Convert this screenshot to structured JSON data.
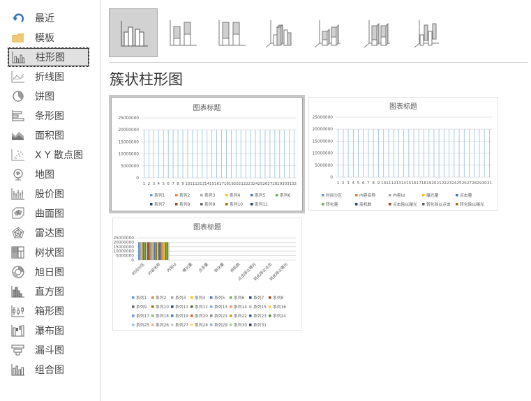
{
  "sidebar": {
    "items": [
      {
        "label": "最近",
        "icon": "recent-icon"
      },
      {
        "label": "模板",
        "icon": "folder-icon"
      },
      {
        "label": "柱形图",
        "icon": "column-chart-icon",
        "selected": true
      },
      {
        "label": "折线图",
        "icon": "line-chart-icon"
      },
      {
        "label": "饼图",
        "icon": "pie-chart-icon"
      },
      {
        "label": "条形图",
        "icon": "bar-chart-icon"
      },
      {
        "label": "面积图",
        "icon": "area-chart-icon"
      },
      {
        "label": "X Y 散点图",
        "icon": "scatter-chart-icon"
      },
      {
        "label": "地图",
        "icon": "map-chart-icon"
      },
      {
        "label": "股价图",
        "icon": "stock-chart-icon"
      },
      {
        "label": "曲面图",
        "icon": "surface-chart-icon"
      },
      {
        "label": "雷达图",
        "icon": "radar-chart-icon"
      },
      {
        "label": "树状图",
        "icon": "treemap-chart-icon"
      },
      {
        "label": "旭日图",
        "icon": "sunburst-chart-icon"
      },
      {
        "label": "直方图",
        "icon": "histogram-chart-icon"
      },
      {
        "label": "箱形图",
        "icon": "box-whisker-chart-icon"
      },
      {
        "label": "瀑布图",
        "icon": "waterfall-chart-icon"
      },
      {
        "label": "漏斗图",
        "icon": "funnel-chart-icon"
      },
      {
        "label": "组合图",
        "icon": "combo-chart-icon"
      }
    ]
  },
  "subtypes": [
    {
      "name": "clustered-column",
      "selected": true
    },
    {
      "name": "stacked-column"
    },
    {
      "name": "100-stacked-column"
    },
    {
      "name": "3d-clustered-column"
    },
    {
      "name": "3d-stacked-column"
    },
    {
      "name": "3d-100-stacked-column"
    },
    {
      "name": "3d-column"
    }
  ],
  "main": {
    "heading": "簇状柱形图"
  },
  "chart_data": [
    {
      "type": "bar",
      "title": "图表标题",
      "selected": true,
      "categories": [
        "1",
        "2",
        "3",
        "4",
        "5",
        "6",
        "7",
        "8",
        "9",
        "10",
        "11",
        "12",
        "13",
        "14",
        "15",
        "16",
        "17",
        "18",
        "19",
        "20",
        "21",
        "22",
        "23",
        "24",
        "25",
        "26",
        "27",
        "28",
        "29",
        "30",
        "31",
        "32"
      ],
      "yticks": [
        "25000000",
        "20000000",
        "15000000",
        "10000000",
        "5000000",
        "0"
      ],
      "ylim": [
        0,
        25000000
      ],
      "bar_value": 20000000,
      "legend": [
        {
          "name": "系列1",
          "color": "#5b9bd5"
        },
        {
          "name": "系列2",
          "color": "#ed7d31"
        },
        {
          "name": "系列3",
          "color": "#a5a5a5"
        },
        {
          "name": "系列4",
          "color": "#ffc000"
        },
        {
          "name": "系列5",
          "color": "#4472c4"
        },
        {
          "name": "系列6",
          "color": "#70ad47"
        },
        {
          "name": "系列7",
          "color": "#264478"
        },
        {
          "name": "系列8",
          "color": "#9e480e"
        },
        {
          "name": "系列9",
          "color": "#636363"
        },
        {
          "name": "系列10",
          "color": "#997300"
        },
        {
          "name": "系列11",
          "color": "#1f3864"
        }
      ],
      "legend_position": "bottom"
    },
    {
      "type": "bar",
      "title": "图表标题",
      "categories": [
        "1",
        "2",
        "3",
        "4",
        "5",
        "6",
        "7",
        "8",
        "9",
        "10",
        "11",
        "12",
        "13",
        "14",
        "15",
        "16",
        "17",
        "18",
        "19",
        "20",
        "21",
        "22",
        "23",
        "24",
        "25",
        "26",
        "27",
        "28",
        "29",
        "30",
        "31"
      ],
      "yticks": [
        "25000000",
        "20000000",
        "15000000",
        "10000000",
        "5000000",
        "0"
      ],
      "ylim": [
        0,
        25000000
      ],
      "bar_value": 20000000,
      "legend": [
        {
          "name": "时间分区",
          "color": "#5b9bd5"
        },
        {
          "name": "内容名称",
          "color": "#ed7d31"
        },
        {
          "name": "内容id",
          "color": "#a5a5a5"
        },
        {
          "name": "曝光量",
          "color": "#ffc000"
        },
        {
          "name": "点击量",
          "color": "#4472c4"
        },
        {
          "name": "转化量",
          "color": "#70ad47"
        },
        {
          "name": "商机数",
          "color": "#264478"
        },
        {
          "name": "点击除以曝光",
          "color": "#9e480e"
        },
        {
          "name": "转化除以点击",
          "color": "#636363"
        },
        {
          "name": "转化除以曝光",
          "color": "#997300"
        }
      ],
      "legend_position": "bottom"
    },
    {
      "type": "bar",
      "title": "图表标题",
      "categories": [
        "时间分区",
        "内容名称",
        "内容id",
        "曝光量",
        "点击量",
        "转化量",
        "商机数",
        "点击除以曝光",
        "转化除以点击",
        "转化除以曝光"
      ],
      "yticks": [
        "25000000",
        "20000000",
        "15000000",
        "10000000",
        "5000000",
        "0"
      ],
      "ylim": [
        0,
        25000000
      ],
      "bar_value": 20000000,
      "legend": [
        {
          "name": "系列1",
          "color": "#5b9bd5"
        },
        {
          "name": "系列2",
          "color": "#ed7d31"
        },
        {
          "name": "系列3",
          "color": "#a5a5a5"
        },
        {
          "name": "系列4",
          "color": "#ffc000"
        },
        {
          "name": "系列5",
          "color": "#4472c4"
        },
        {
          "name": "系列6",
          "color": "#70ad47"
        },
        {
          "name": "系列7",
          "color": "#264478"
        },
        {
          "name": "系列8",
          "color": "#9e480e"
        },
        {
          "name": "系列9",
          "color": "#636363"
        },
        {
          "name": "系列10",
          "color": "#997300"
        },
        {
          "name": "系列11",
          "color": "#264478"
        },
        {
          "name": "系列12",
          "color": "#43682b"
        },
        {
          "name": "系列13",
          "color": "#7cafdd"
        },
        {
          "name": "系列14",
          "color": "#f1975a"
        },
        {
          "name": "系列15",
          "color": "#b7b7b7"
        },
        {
          "name": "系列16",
          "color": "#ffcd33"
        },
        {
          "name": "系列17",
          "color": "#698ed0"
        },
        {
          "name": "系列18",
          "color": "#8cc168"
        },
        {
          "name": "系列19",
          "color": "#327dc2"
        },
        {
          "name": "系列20",
          "color": "#d26012"
        },
        {
          "name": "系列21",
          "color": "#848484"
        },
        {
          "name": "系列22",
          "color": "#cc9a00"
        },
        {
          "name": "系列23",
          "color": "#335aa1"
        },
        {
          "name": "系列24",
          "color": "#5a8a39"
        },
        {
          "name": "系列25",
          "color": "#9dc3e6"
        },
        {
          "name": "系列26",
          "color": "#f4b183"
        },
        {
          "name": "系列27",
          "color": "#c9c9c9"
        },
        {
          "name": "系列28",
          "color": "#ffd966"
        },
        {
          "name": "系列29",
          "color": "#8faadc"
        },
        {
          "name": "系列30",
          "color": "#a9d18e"
        },
        {
          "name": "系列31",
          "color": "#1f3864"
        }
      ],
      "legend_position": "bottom"
    }
  ]
}
